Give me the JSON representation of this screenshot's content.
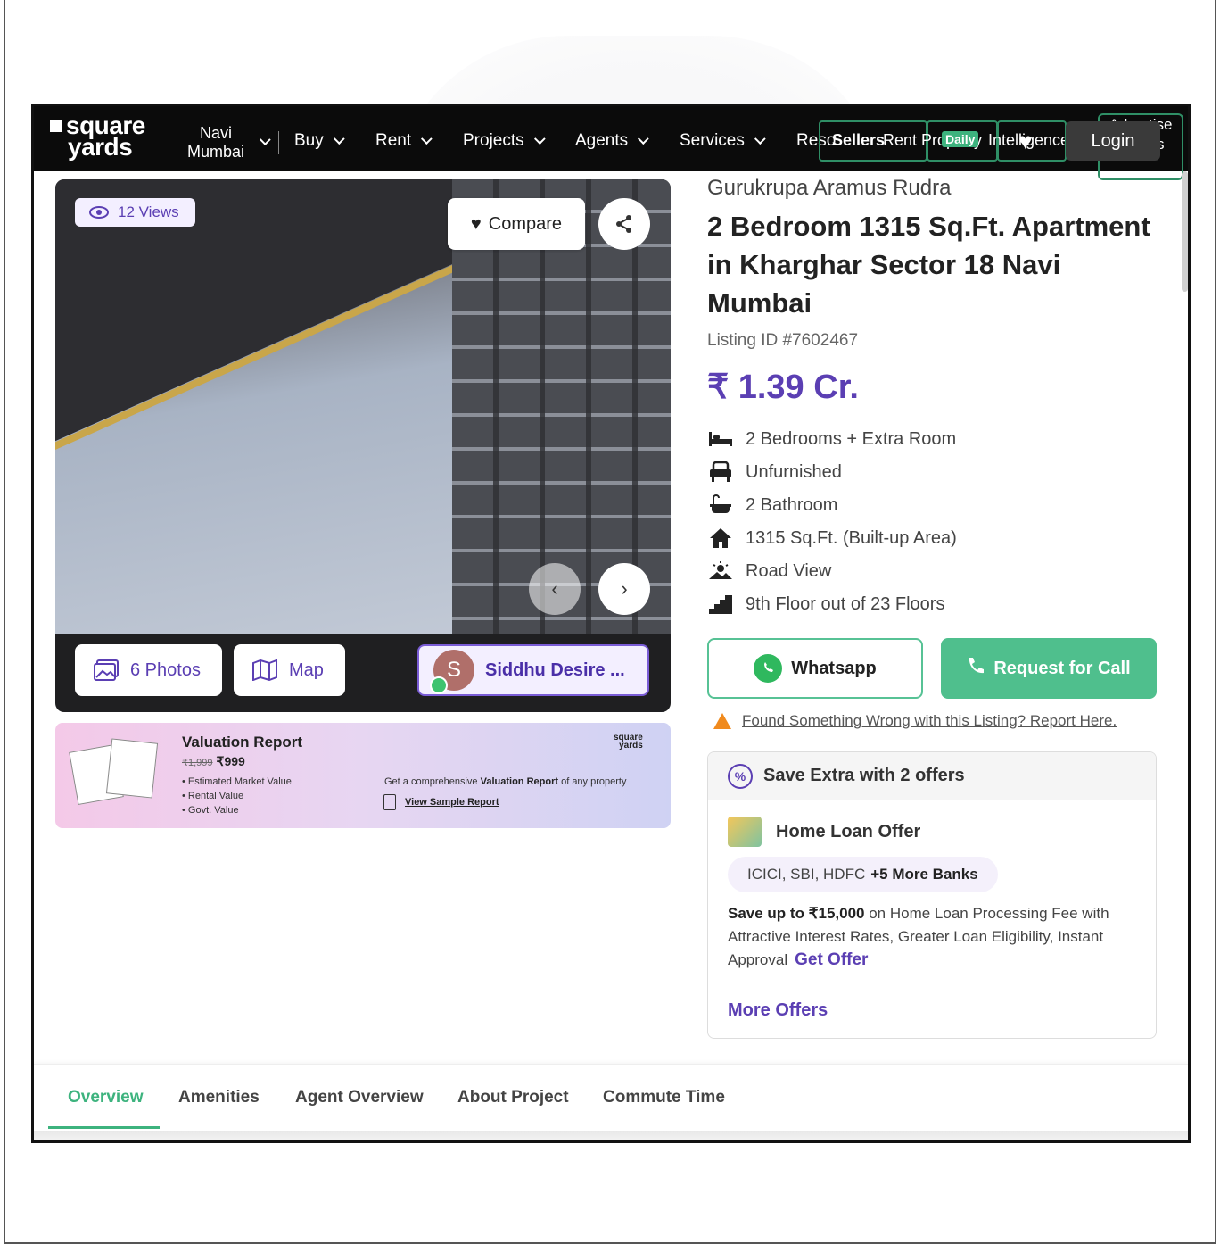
{
  "nav": {
    "logo_line1": "square",
    "logo_line2": "yards",
    "city_line1": "Navi",
    "city_line2": "Mumbai",
    "menu": [
      "Buy",
      "Rent",
      "Projects",
      "Agents",
      "Services"
    ],
    "resources_label": "Reso",
    "overlay_sell": "Sellers",
    "overlay_rent": "Rent Property",
    "overlay_daily": "Daily",
    "overlay_intel": "Intelligence",
    "login_label": "Login",
    "advertise_label": "Advertise with us"
  },
  "gallery": {
    "views_label": "12 Views",
    "compare_label": "Compare",
    "photos_label": "6 Photos",
    "map_label": "Map",
    "agent_initial": "S",
    "agent_name": "Siddhu Desire ..."
  },
  "valuation": {
    "title": "Valuation Report",
    "old_price": "₹1,999",
    "price": "₹999",
    "items": [
      "Estimated Market Value",
      "Rental Value",
      "Govt. Value"
    ],
    "logo_line1": "square",
    "logo_line2": "yards",
    "desc_pre": "Get a comprehensive ",
    "desc_bold": "Valuation Report",
    "desc_post": " of any property",
    "sample_label": "View Sample Report"
  },
  "listing": {
    "project_name": "Gurukrupa Aramus Rudra",
    "title": "2 Bedroom 1315 Sq.Ft. Apartment in Kharghar Sector 18 Navi Mumbai",
    "listing_id": "Listing ID #7602467",
    "price": "₹ 1.39 Cr.",
    "features": [
      {
        "icon": "bed-icon",
        "label": "2 Bedrooms + Extra Room"
      },
      {
        "icon": "armchair-icon",
        "label": "Unfurnished"
      },
      {
        "icon": "bathtub-icon",
        "label": "2 Bathroom"
      },
      {
        "icon": "home-icon",
        "label": "1315 Sq.Ft. (Built-up Area)"
      },
      {
        "icon": "view-icon",
        "label": "Road View"
      },
      {
        "icon": "stairs-icon",
        "label": "9th Floor out of 23 Floors"
      }
    ]
  },
  "actions": {
    "whatsapp_label": "Whatsapp",
    "call_label": "Request for Call",
    "report_label": "Found Something Wrong with this Listing? Report Here."
  },
  "offers": {
    "header": "Save Extra with 2 offers",
    "loan_title": "Home Loan Offer",
    "banks_plain": "ICICI, SBI, HDFC",
    "banks_more": "+5 More Banks",
    "desc_bold": "Save up to ₹15,000",
    "desc_rest": " on Home Loan Processing Fee with Attractive Interest Rates, Greater Loan Eligibility, Instant Approval",
    "get_offer_label": "Get Offer",
    "more_offers_label": "More Offers"
  },
  "tabs": [
    "Overview",
    "Amenities",
    "Agent Overview",
    "About Project",
    "Commute Time"
  ],
  "colors": {
    "brand_purple": "#5b3fb3",
    "brand_green": "#4fbf8d",
    "nav_bg": "#0b0b0b"
  }
}
